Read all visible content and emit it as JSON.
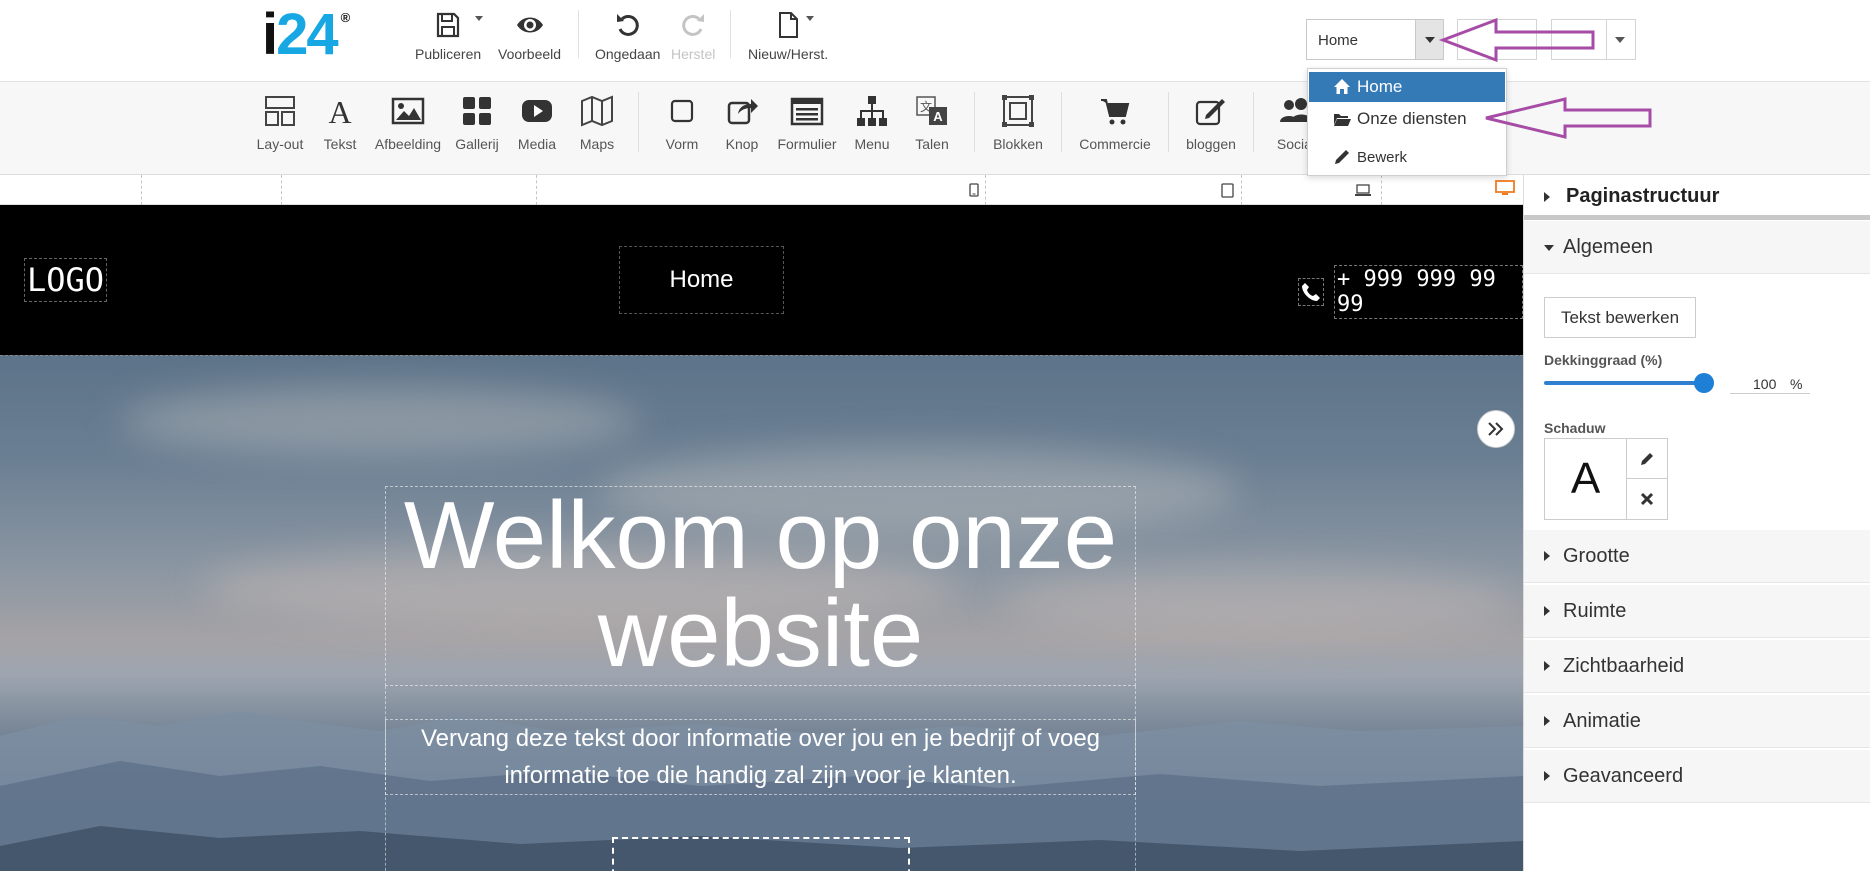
{
  "app": {
    "logo_main": "i",
    "logo_accent": "24",
    "logo_mark": "®",
    "brand_color": "#17a8e3"
  },
  "top_toolbar": {
    "publish": "Publiceren",
    "preview": "Voorbeeld",
    "undo": "Ongedaan",
    "redo": "Herstel",
    "new_restore": "Nieuw/Herst."
  },
  "page_selector": {
    "value": "Home"
  },
  "page_dropdown": {
    "items": [
      {
        "label": "Home",
        "icon": "home-icon",
        "active": true
      },
      {
        "label": "Onze diensten",
        "icon": "folder-open-icon",
        "active": false
      },
      {
        "label": "Bewerk",
        "icon": "pencil-icon",
        "active": false
      }
    ],
    "highlight_color": "#337ab7"
  },
  "element_toolbar": {
    "items": [
      {
        "label": "Lay-out",
        "icon": "layout-icon"
      },
      {
        "label": "Tekst",
        "icon": "text-icon"
      },
      {
        "label": "Afbeelding",
        "icon": "image-icon"
      },
      {
        "label": "Gallerij",
        "icon": "gallery-icon"
      },
      {
        "label": "Media",
        "icon": "youtube-icon"
      },
      {
        "label": "Maps",
        "icon": "map-icon"
      },
      {
        "label": "Vorm",
        "icon": "shape-icon"
      },
      {
        "label": "Knop",
        "icon": "share-button-icon"
      },
      {
        "label": "Formulier",
        "icon": "form-icon"
      },
      {
        "label": "Menu",
        "icon": "sitemap-icon"
      },
      {
        "label": "Talen",
        "icon": "translate-icon"
      },
      {
        "label": "Blokken",
        "icon": "blocks-icon"
      },
      {
        "label": "Commercie",
        "icon": "cart-icon"
      },
      {
        "label": "bloggen",
        "icon": "blog-edit-icon"
      },
      {
        "label": "Social",
        "icon": "users-icon"
      }
    ]
  },
  "site": {
    "logo": "LOGO",
    "nav_item": "Home",
    "phone": "+ 999 999 99 99",
    "hero_title": "Welkom op onze website",
    "hero_desc": "Vervang deze tekst door informatie over jou en je bedrijf of voeg informatie toe die handig zal zijn voor je klanten."
  },
  "panel": {
    "page_structure": "Paginastructuur",
    "general": "Algemeen",
    "edit_text": "Tekst bewerken",
    "opacity_label": "Dekkinggraad (%)",
    "opacity_value": "100",
    "opacity_unit": "%",
    "opacity_fraction": 1.0,
    "shadow_label": "Schaduw",
    "shadow_preview": "A",
    "sections": [
      "Grootte",
      "Ruimte",
      "Zichtbaarheid",
      "Animatie",
      "Geavanceerd"
    ]
  },
  "colors": {
    "accent": "#1e7fd6",
    "annotation_arrow": "#a64ca6",
    "desktop_icon": "#f07c1f"
  }
}
